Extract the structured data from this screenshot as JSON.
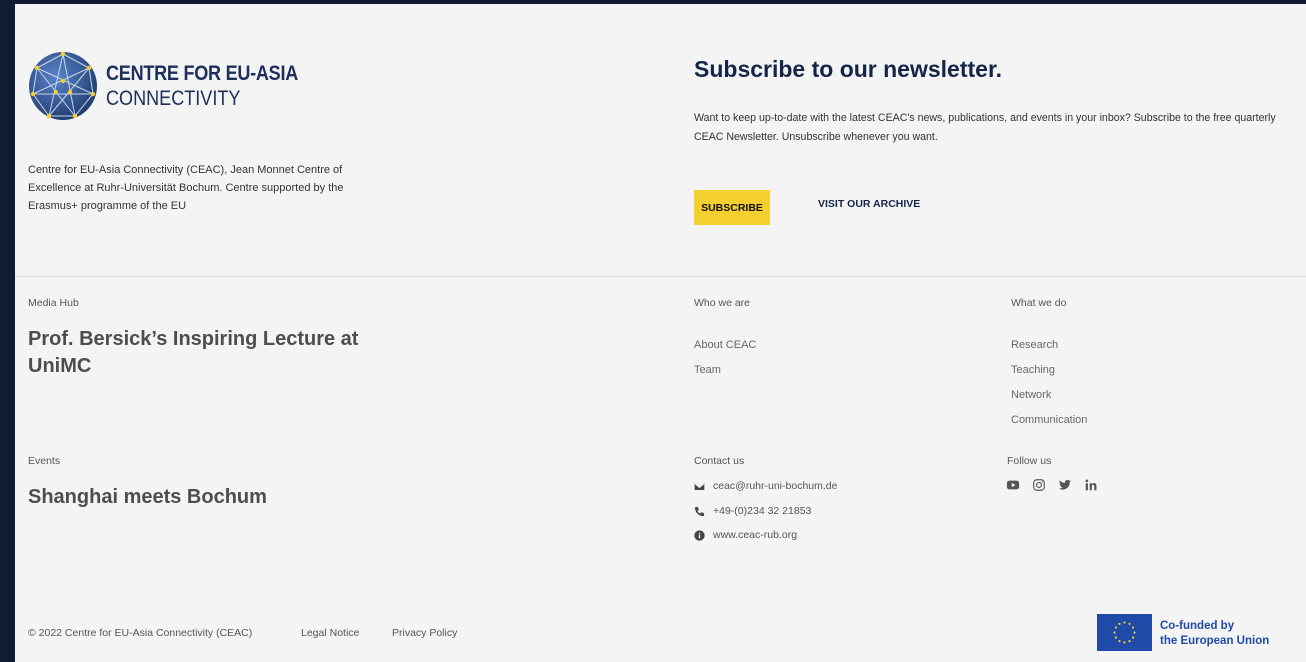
{
  "brand": {
    "line1": "CENTRE FOR EU-ASIA",
    "line2": "CONNECTIVITY",
    "description": "Centre for EU-Asia Connectivity (CEAC), Jean Monnet Centre of Excellence at Ruhr-Universität Bochum. Centre supported by the Erasmus+ programme of the EU"
  },
  "newsletter": {
    "title": "Subscribe to our newsletter.",
    "text": "Want to keep up-to-date with the latest CEAC's news, publications, and events in your inbox? Subscribe to the free quarterly CEAC Newsletter. Unsubscribe whenever you want.",
    "subscribe_label": "SUBSCRIBE",
    "archive_label": "VISIT OUR ARCHIVE"
  },
  "media_hub": {
    "label": "Media Hub",
    "headline": "Prof. Bersick’s Inspiring Lecture at UniMC"
  },
  "events": {
    "label": "Events",
    "headline": "Shanghai meets Bochum"
  },
  "who_we_are": {
    "label": "Who we are",
    "links": [
      "About CEAC",
      "Team"
    ]
  },
  "what_we_do": {
    "label": "What we do",
    "links": [
      "Research",
      "Teaching",
      "Network",
      "Communication"
    ]
  },
  "contact": {
    "label": "Contact us",
    "email": "ceac@ruhr-uni-bochum.de",
    "phone": "+49-(0)234 32 21853",
    "website": "www.ceac-rub.org",
    "icons": [
      "envelope-icon",
      "phone-icon",
      "info-icon"
    ]
  },
  "follow": {
    "label": "Follow us",
    "icons": [
      "youtube-icon",
      "instagram-icon",
      "twitter-icon",
      "linkedin-icon"
    ]
  },
  "footer": {
    "copyright": "© 2022 Centre for EU-Asia Connectivity (CEAC)",
    "legal": "Legal Notice",
    "privacy": "Privacy Policy",
    "eu_line1": "Co-funded by",
    "eu_line2": "the European Union"
  },
  "colors": {
    "frame": "#0f1c33",
    "background": "#f4f4f5",
    "accent_yellow": "#f3cf2f",
    "navy": "#152547",
    "eu_blue": "#1f4aa8"
  }
}
